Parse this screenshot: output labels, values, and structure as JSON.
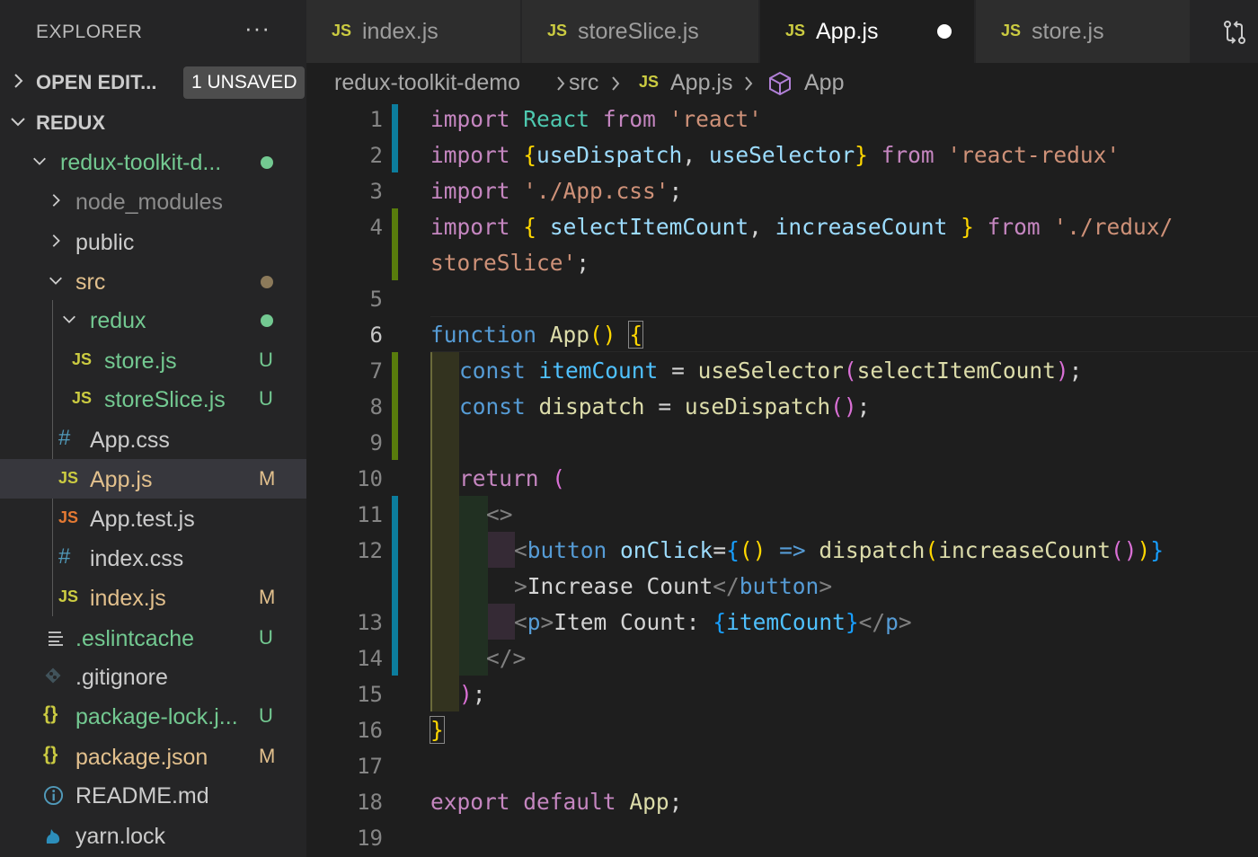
{
  "explorer": {
    "title": "EXPLORER",
    "more": "···",
    "open_editors": {
      "label": "OPEN EDIT...",
      "badge": "1 UNSAVED"
    },
    "workspace": {
      "label": "REDUX"
    },
    "tree": [
      {
        "name": "redux-toolkit-d...",
        "kind": "folder-open",
        "status_dot": "#73c991"
      },
      {
        "name": "node_modules",
        "kind": "folder-closed"
      },
      {
        "name": "public",
        "kind": "folder-closed"
      },
      {
        "name": "src",
        "kind": "folder-open",
        "status_dot": "#8c7a5a"
      },
      {
        "name": "redux",
        "kind": "folder-open",
        "status_dot": "#73c991"
      },
      {
        "name": "store.js",
        "kind": "js-file",
        "icon": "JS",
        "status": "U"
      },
      {
        "name": "storeSlice.js",
        "kind": "js-file",
        "icon": "JS",
        "status": "U"
      },
      {
        "name": "App.css",
        "kind": "css-file",
        "icon": "#"
      },
      {
        "name": "App.js",
        "kind": "js-file",
        "icon": "JS",
        "status": "M",
        "selected": true
      },
      {
        "name": "App.test.js",
        "kind": "test-file",
        "icon": "JS"
      },
      {
        "name": "index.css",
        "kind": "css-file",
        "icon": "#"
      },
      {
        "name": "index.js",
        "kind": "js-file",
        "icon": "JS",
        "status": "M"
      },
      {
        "name": ".eslintcache",
        "kind": "text-file",
        "icon": "lines-icon",
        "status": "U"
      },
      {
        "name": ".gitignore",
        "kind": "git-file",
        "icon": "git-diamond-icon"
      },
      {
        "name": "package-lock.j...",
        "kind": "json-file",
        "icon": "{}",
        "status": "U"
      },
      {
        "name": "package.json",
        "kind": "json-file",
        "icon": "{}",
        "status": "M"
      },
      {
        "name": "README.md",
        "kind": "md-file",
        "icon": "info-icon"
      },
      {
        "name": "yarn.lock",
        "kind": "yarn-file",
        "icon": "yarn-cat-icon"
      }
    ]
  },
  "tabs": [
    {
      "icon": "JS",
      "label": "index.js"
    },
    {
      "icon": "JS",
      "label": "storeSlice.js"
    },
    {
      "icon": "JS",
      "label": "App.js",
      "active": true,
      "unsaved": true
    },
    {
      "icon": "JS",
      "label": "store.js"
    }
  ],
  "breadcrumb": {
    "project": "redux-toolkit-demo",
    "folder": "src",
    "file_icon": "JS",
    "file": "App.js",
    "symbol": "App"
  },
  "editor": {
    "line_numbers": [
      "1",
      "2",
      "3",
      "4",
      "5",
      "6",
      "7",
      "8",
      "9",
      "10",
      "11",
      "12",
      "13",
      "14",
      "15",
      "16",
      "17",
      "18",
      "19"
    ],
    "current_line": "6",
    "code": {
      "l1": [
        "import",
        "React",
        "from",
        "'react'"
      ],
      "l2": [
        "import",
        "{",
        "useDispatch",
        ",",
        "useSelector",
        "}",
        "from",
        "'react-redux'"
      ],
      "l3": [
        "import",
        "'./App.css'",
        ";"
      ],
      "l4": [
        "import",
        "{",
        "selectItemCount",
        ",",
        "increaseCount",
        "}",
        "from",
        "'./redux/"
      ],
      "l4b": [
        "storeSlice'",
        ";"
      ],
      "l6": [
        "function",
        "App",
        "()",
        "{"
      ],
      "l7": [
        "const",
        "itemCount",
        "=",
        "useSelector",
        "(",
        "selectItemCount",
        ")",
        ";"
      ],
      "l8": [
        "const",
        "dispatch",
        "=",
        "useDispatch",
        "()",
        ";"
      ],
      "l10": [
        "return",
        "("
      ],
      "l11": [
        "<>"
      ],
      "l12": [
        "<",
        "button",
        "onClick",
        "=",
        "{",
        "()",
        "=>",
        "dispatch",
        "(",
        "increaseCount",
        "()",
        ")",
        "}"
      ],
      "l12b": [
        ">",
        "Increase Count",
        "</",
        "button",
        ">"
      ],
      "l13": [
        "<",
        "p",
        ">",
        "Item Count: ",
        "{",
        "itemCount",
        "}",
        "</",
        "p",
        ">"
      ],
      "l14": [
        "</>"
      ],
      "l15": [
        ")",
        ";"
      ],
      "l16": [
        "}"
      ],
      "l18": [
        "export",
        "default",
        "App",
        ";"
      ]
    }
  },
  "colors": {
    "keyword": "#c586c0",
    "string": "#ce9178",
    "class": "#4ec9b0",
    "variable": "#9cdcfe",
    "constant": "#4fc1ff",
    "function": "#dcdcaa",
    "js_icon": "#cbcb41",
    "untracked": "#73c991",
    "modified": "#e2c08d",
    "gutter_added": "#587c0c",
    "gutter_modified": "#0c7d9d"
  }
}
